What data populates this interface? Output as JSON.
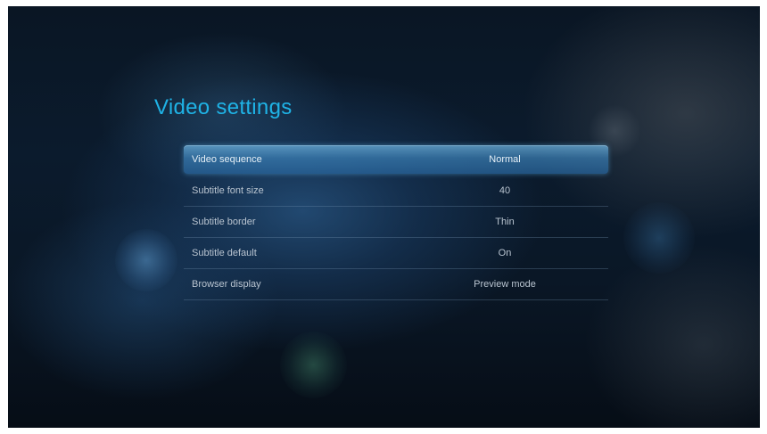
{
  "page": {
    "title": "Video settings"
  },
  "settings": [
    {
      "label": "Video sequence",
      "value": "Normal",
      "selected": true
    },
    {
      "label": "Subtitle font size",
      "value": "40",
      "selected": false
    },
    {
      "label": "Subtitle border",
      "value": "Thin",
      "selected": false
    },
    {
      "label": "Subtitle default",
      "value": "On",
      "selected": false
    },
    {
      "label": "Browser display",
      "value": "Preview mode",
      "selected": false
    }
  ],
  "colors": {
    "title": "#1fb3e6",
    "text": "#b9c4d0",
    "selection": "#4a8fc4",
    "background": "#0a1726"
  }
}
